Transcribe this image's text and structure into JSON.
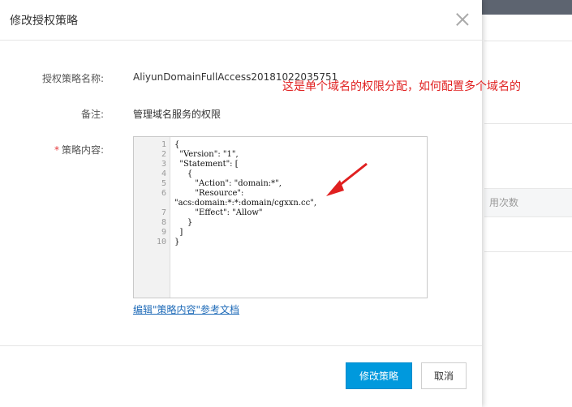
{
  "background": {
    "column_text": "用次数"
  },
  "modal": {
    "title": "修改授权策略",
    "fields": {
      "policy_name_label": "授权策略名称:",
      "policy_name_value": "AliyunDomainFullAccess20181022035751",
      "note_label": "备注:",
      "note_value": "管理域名服务的权限",
      "content_required_mark": "*",
      "content_label": "策略内容:"
    },
    "editor": {
      "line_numbers": [
        "1",
        "2",
        "3",
        "4",
        "5",
        "6",
        "",
        "7",
        "8",
        "9",
        "10"
      ],
      "lines": [
        "{",
        "  \"Version\": \"1\",",
        "  \"Statement\": [",
        "     {",
        "        \"Action\": \"domain:*\",",
        "        \"Resource\":",
        "\"acs:domain:*:*:domain/cgxxn.cc\",",
        "        \"Effect\": \"Allow\"",
        "     }",
        "  ]",
        "}"
      ]
    },
    "doc_link": "编辑\"策略内容\"参考文档",
    "buttons": {
      "submit": "修改策略",
      "cancel": "取消"
    }
  },
  "annotation": {
    "text": "这是单个域名的权限分配，如何配置多个域名的",
    "color": "#e02020"
  }
}
